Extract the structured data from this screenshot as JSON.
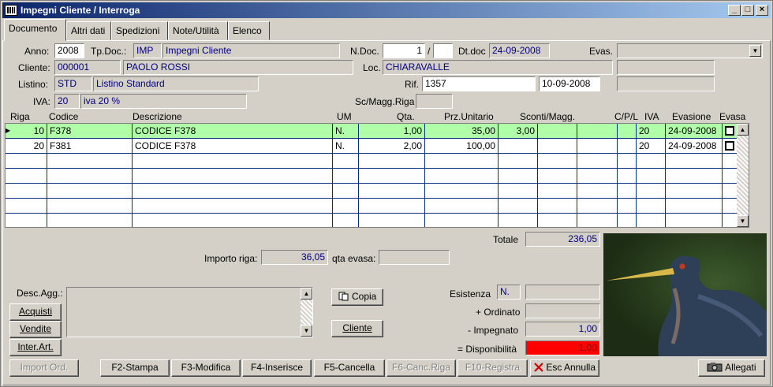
{
  "window": {
    "title": "Impegni Cliente / Interroga"
  },
  "tabs": [
    "Documento",
    "Altri dati",
    "Spedizioni",
    "Note/Utilità",
    "Elenco"
  ],
  "form": {
    "anno_label": "Anno:",
    "anno": "2008",
    "tpdoc_label": "Tp.Doc.:",
    "tpdoc_code": "IMP",
    "tpdoc_desc": "Impegni Cliente",
    "ndoc_label": "N.Doc.",
    "ndoc": "1",
    "ndoc_sep": "/",
    "ndoc_suffix": "",
    "dtdoc_label": "Dt.doc",
    "dtdoc": "24-09-2008",
    "evas_label": "Evas.",
    "evas": "",
    "cliente_label": "Cliente:",
    "cliente_code": "000001",
    "cliente_name": "PAOLO ROSSI",
    "loc_label": "Loc.",
    "loc": "CHIARAVALLE",
    "listino_label": "Listino:",
    "listino_code": "STD",
    "listino_desc": "Listino Standard",
    "rif_label": "Rif.",
    "rif": "1357",
    "rif_date": "10-09-2008",
    "iva_label": "IVA:",
    "iva_code": "20",
    "iva_desc": "iva 20 %",
    "scmagg_label": "Sc/Magg.Riga",
    "scmagg": ""
  },
  "grid": {
    "headers": [
      "Riga",
      "Codice",
      "Descrizione",
      "UM",
      "Qta.",
      "Prz.Unitario",
      "Sconti/Magg.",
      "C/P/L",
      "IVA",
      "Evasione",
      "Evasa"
    ],
    "rows": [
      {
        "riga": "10",
        "codice": "F378",
        "descrizione": "CODICE F378",
        "um": "N.",
        "qta": "1,00",
        "prezzo": "35,00",
        "sconto": "3,00",
        "iva": "20",
        "evasione": "24-09-2008",
        "selected": true
      },
      {
        "riga": "20",
        "codice": "F381",
        "descrizione": "CODICE F378",
        "um": "N.",
        "qta": "2,00",
        "prezzo": "100,00",
        "sconto": "",
        "iva": "20",
        "evasione": "24-09-2008",
        "selected": false
      }
    ]
  },
  "totals": {
    "totale_label": "Totale",
    "totale": "236,05",
    "importo_riga_label": "Importo riga:",
    "importo_riga": "36,05",
    "qta_evasa_label": "qta evasa:",
    "qta_evasa": ""
  },
  "desc_agg_label": "Desc.Agg.:",
  "side_buttons": {
    "acquisti": "Acquisti",
    "vendite": "Vendite",
    "interart": "Inter.Art."
  },
  "mid_buttons": {
    "copia": "Copia",
    "cliente": "Cliente"
  },
  "stock": {
    "esistenza_label": "Esistenza",
    "esistenza_um": "N.",
    "esistenza": "",
    "ordinato_label": "+ Ordinato",
    "ordinato": "",
    "impegnato_label": "- Impegnato",
    "impegnato": "1,00",
    "disponibilita_label": "= Disponibilità",
    "disponibilita": "1,00",
    "alert_color": "#ff0000"
  },
  "toolbar": {
    "import": "Import Ord.",
    "stampa": "F2-Stampa",
    "modifica": "F3-Modifica",
    "inserisce": "F4-Inserisce",
    "cancella": "F5-Cancella",
    "canc_riga": "F6-Canc.Riga",
    "registra": "F10-Registra",
    "esc": "Esc Annulla",
    "allegati": "Allegati"
  },
  "colors": {
    "selected_row": "#b0ffa8",
    "title_start": "#0a246a",
    "field_text": "#000080"
  }
}
